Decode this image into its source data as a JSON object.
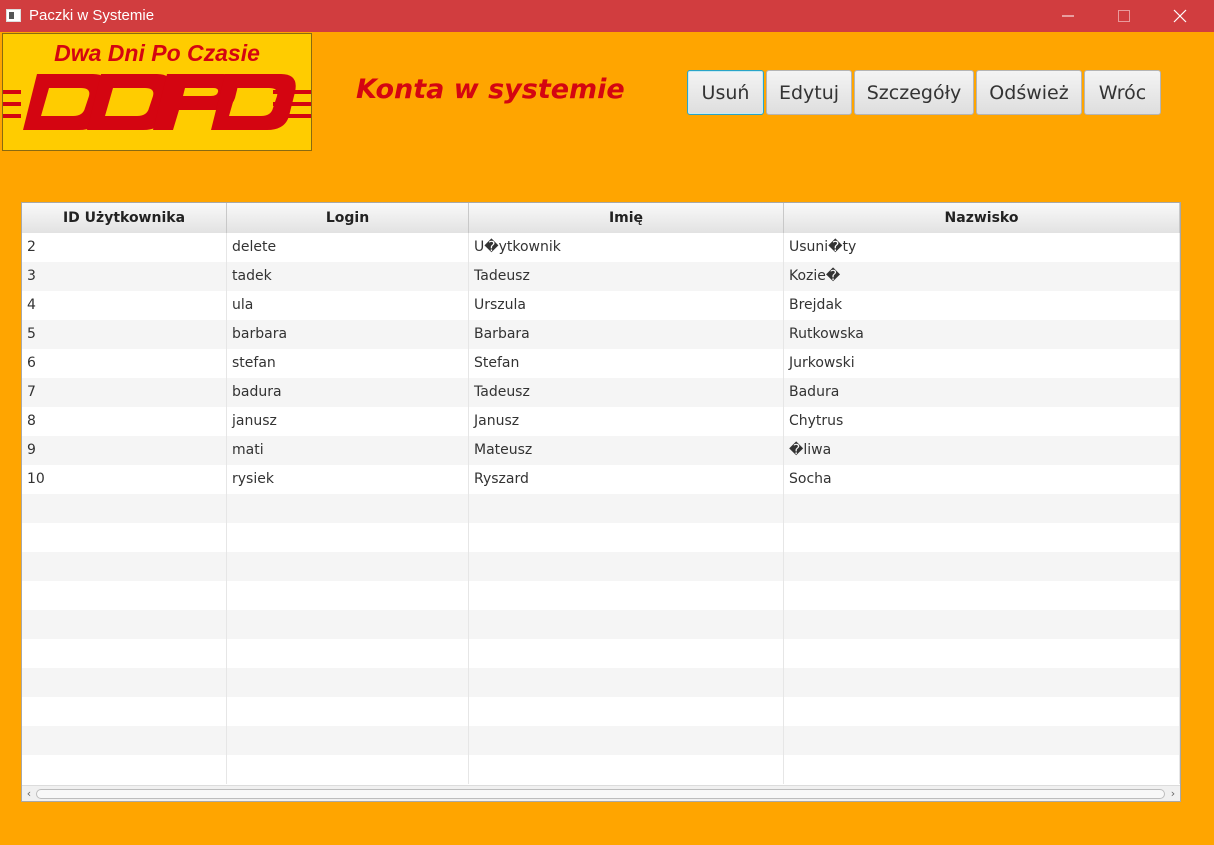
{
  "window": {
    "title": "Paczki w Systemie",
    "controls": [
      "minimize-icon",
      "maximize-icon",
      "close-icon"
    ]
  },
  "logo": {
    "tagline": "Dwa Dni Po Czasie",
    "mark_letters": "DDPD",
    "colors": {
      "background": "#ffcc00",
      "text": "#d40511"
    }
  },
  "heading": "Konta w systemie",
  "toolbar": {
    "delete_label": "Usuń",
    "edit_label": "Edytuj",
    "details_label": "Szczegóły",
    "refresh_label": "Odśwież",
    "back_label": "Wróc"
  },
  "table": {
    "columns": [
      "ID Użytkownika",
      "Login",
      "Imię",
      "Nazwisko"
    ],
    "rows": [
      [
        "2",
        "delete",
        "U�ytkownik",
        "Usuni�ty"
      ],
      [
        "3",
        "tadek",
        "Tadeusz",
        "Kozie�"
      ],
      [
        "4",
        "ula",
        "Urszula",
        "Brejdak"
      ],
      [
        "5",
        "barbara",
        "Barbara",
        "Rutkowska"
      ],
      [
        "6",
        "stefan",
        "Stefan",
        "Jurkowski"
      ],
      [
        "7",
        "badura",
        "Tadeusz",
        "Badura"
      ],
      [
        "8",
        "janusz",
        "Janusz",
        "Chytrus"
      ],
      [
        "9",
        "mati",
        "Mateusz",
        "�liwa"
      ],
      [
        "10",
        "rysiek",
        "Ryszard",
        "Socha"
      ]
    ],
    "empty_rows": 10
  },
  "colors": {
    "titlebar": "#d13d3f",
    "background": "#ffa500",
    "heading": "#d40511"
  }
}
